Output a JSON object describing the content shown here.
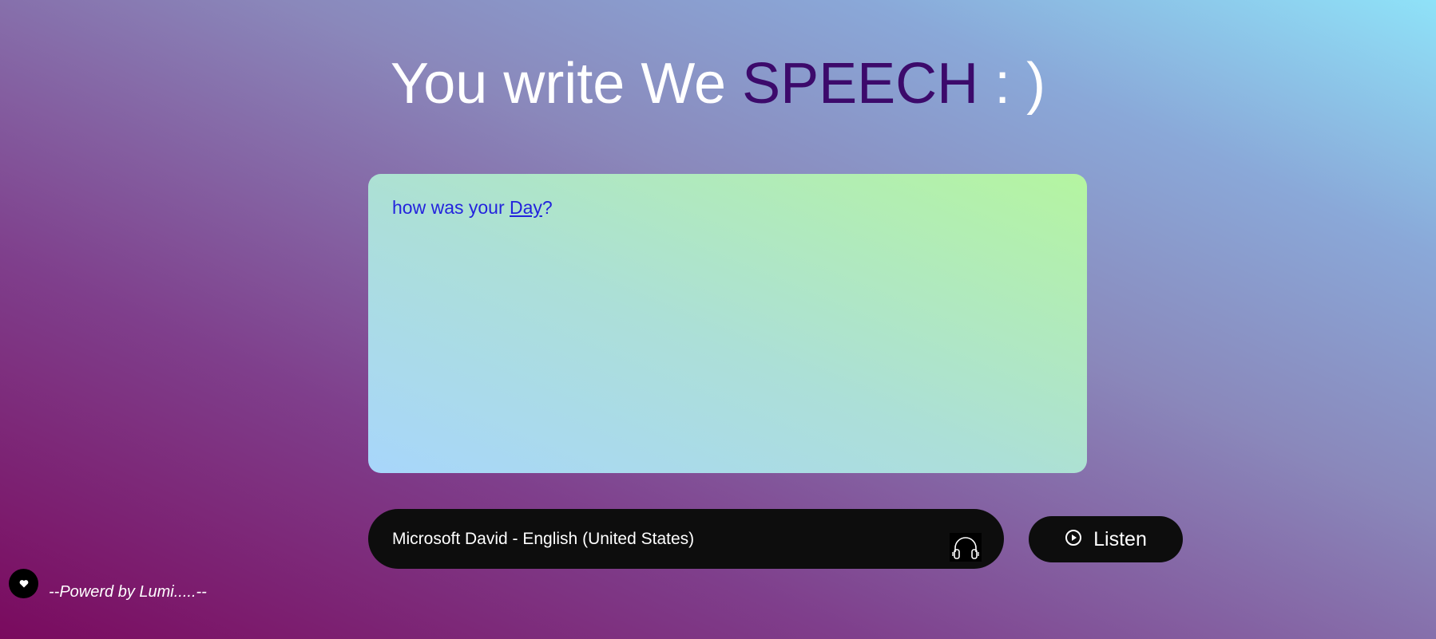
{
  "title": {
    "prefix": "You write We ",
    "accent": "SPEECH",
    "suffix": " : )"
  },
  "editor": {
    "text_before": "how was your ",
    "text_underlined": "Day",
    "text_after": "?"
  },
  "voice_select": {
    "selected": "Microsoft David - English (United States)",
    "icon": "headphones-icon"
  },
  "listen_button": {
    "label": "Listen",
    "icon": "play-circle-icon"
  },
  "footer": {
    "icon": "heart-icon",
    "text": "--Powerd by Lumi.....--"
  },
  "colors": {
    "accent": "#3c0a6b",
    "editor_text": "#2323dd",
    "button_bg": "#0d0d0d"
  }
}
